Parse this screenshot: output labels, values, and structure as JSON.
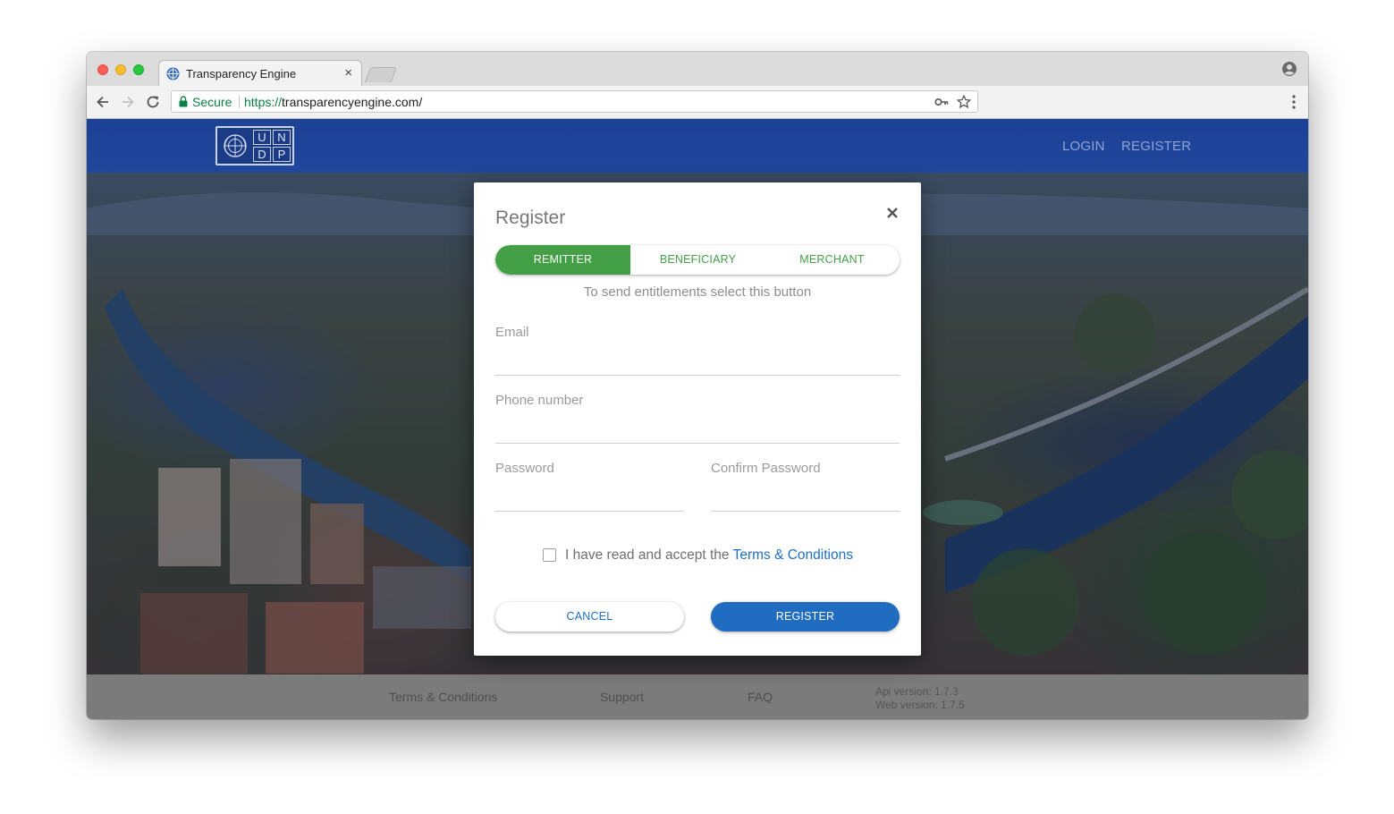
{
  "browser": {
    "tab_title": "Transparency Engine",
    "tab_close": "×",
    "secure_label": "Secure",
    "url_scheme": "https://",
    "url_rest": "transparencyengine.com/"
  },
  "header": {
    "logo_letters": [
      "U",
      "N",
      "D",
      "P"
    ],
    "nav": {
      "login": "LOGIN",
      "register": "REGISTER"
    }
  },
  "modal": {
    "title": "Register",
    "tabs": [
      {
        "label": "REMITTER",
        "active": true
      },
      {
        "label": "BENEFICIARY",
        "active": false
      },
      {
        "label": "MERCHANT",
        "active": false
      }
    ],
    "hint": "To send entitlements select this button",
    "fields": {
      "email": {
        "label": "Email",
        "value": ""
      },
      "phone": {
        "label": "Phone number",
        "value": ""
      },
      "password": {
        "label": "Password",
        "value": ""
      },
      "confirm_password": {
        "label": "Confirm Password",
        "value": ""
      }
    },
    "terms": {
      "text": "I have read and accept the ",
      "link": "Terms & Conditions",
      "checked": false
    },
    "buttons": {
      "cancel": "CANCEL",
      "register": "REGISTER"
    }
  },
  "footer": {
    "links": [
      "Terms & Conditions",
      "Support",
      "FAQ"
    ],
    "api_version": "Api version: 1.7.3",
    "web_version": "Web version: 1.7.5"
  },
  "colors": {
    "brand_blue": "#1f6cc0",
    "remitter_green": "#43a047",
    "navbar_blue": "#1d4196",
    "footer_grey": "#7b7b7b"
  }
}
